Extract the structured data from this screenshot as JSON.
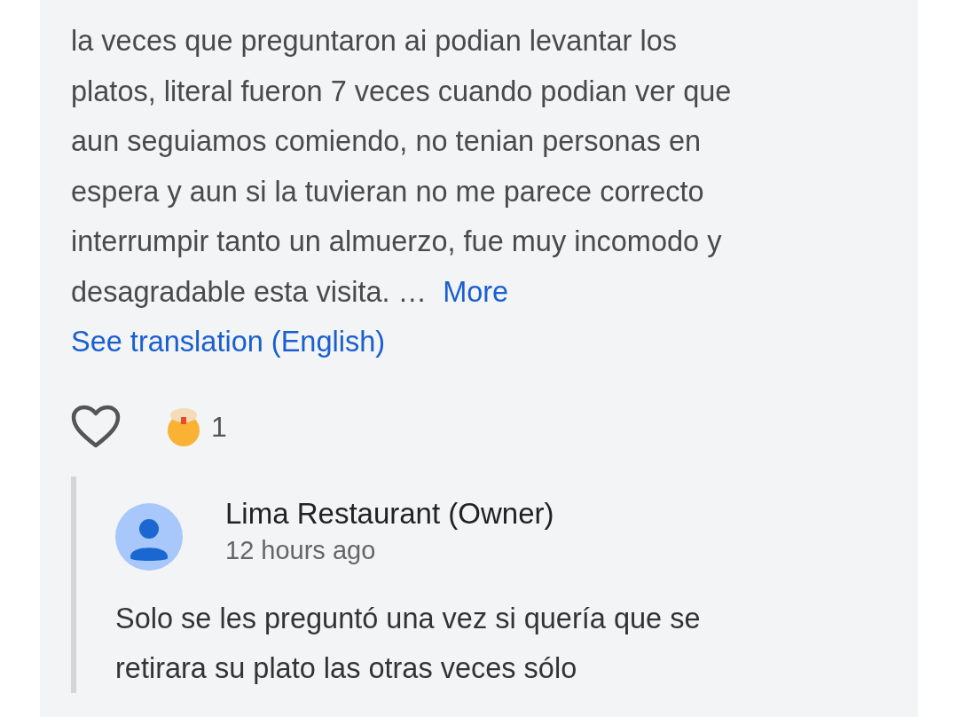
{
  "review": {
    "lines": [
      "la veces que preguntaron ai podian levantar los",
      "platos, literal fueron 7 veces cuando podian ver que",
      "aun seguiamos comiendo, no tenian personas en",
      "espera y aun si la tuvieran no me parece correcto",
      "interrumpir tanto un almuerzo, fue muy incomodo y",
      "desagradable esta visita. …"
    ],
    "more_link": "More",
    "translate_link": "See translation (English)"
  },
  "reactions": {
    "liked": false,
    "count": "1"
  },
  "owner_reply": {
    "name": "Lima Restaurant (Owner)",
    "time": "12 hours ago",
    "lines": [
      "Solo se les preguntó una vez si quería que se",
      "retirara su plato las otras veces sólo"
    ]
  }
}
